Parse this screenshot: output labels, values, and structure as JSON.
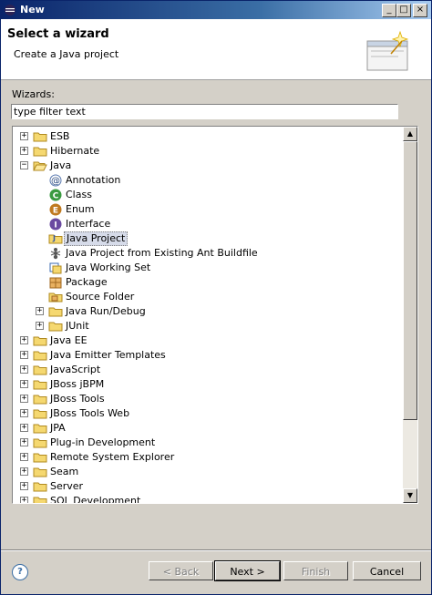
{
  "window": {
    "title": "New",
    "controls": [
      "_",
      "□",
      "×"
    ]
  },
  "header": {
    "title": "Select a wizard",
    "description": "Create a Java project"
  },
  "wizards_label": "Wizards:",
  "filter": {
    "value": "type filter text",
    "placeholder": "type filter text"
  },
  "tree": {
    "nodes": [
      {
        "label": "ESB",
        "level": 0,
        "expander": "+",
        "icon": "folder-icon"
      },
      {
        "label": "Hibernate",
        "level": 0,
        "expander": "+",
        "icon": "folder-icon"
      },
      {
        "label": "Java",
        "level": 0,
        "expander": "−",
        "icon": "folder-open-icon"
      },
      {
        "label": "Annotation",
        "level": 1,
        "expander": "",
        "icon": "annotation-icon"
      },
      {
        "label": "Class",
        "level": 1,
        "expander": "",
        "icon": "class-icon"
      },
      {
        "label": "Enum",
        "level": 1,
        "expander": "",
        "icon": "enum-icon"
      },
      {
        "label": "Interface",
        "level": 1,
        "expander": "",
        "icon": "interface-icon"
      },
      {
        "label": "Java Project",
        "level": 1,
        "expander": "",
        "icon": "java-project-icon",
        "selected": true
      },
      {
        "label": "Java Project from Existing Ant Buildfile",
        "level": 1,
        "expander": "",
        "icon": "ant-icon"
      },
      {
        "label": "Java Working Set",
        "level": 1,
        "expander": "",
        "icon": "working-set-icon"
      },
      {
        "label": "Package",
        "level": 1,
        "expander": "",
        "icon": "package-icon"
      },
      {
        "label": "Source Folder",
        "level": 1,
        "expander": "",
        "icon": "source-folder-icon"
      },
      {
        "label": "Java Run/Debug",
        "level": 1,
        "expander": "+",
        "icon": "folder-icon"
      },
      {
        "label": "JUnit",
        "level": 1,
        "expander": "+",
        "icon": "folder-icon"
      },
      {
        "label": "Java EE",
        "level": 0,
        "expander": "+",
        "icon": "folder-icon"
      },
      {
        "label": "Java Emitter Templates",
        "level": 0,
        "expander": "+",
        "icon": "folder-icon"
      },
      {
        "label": "JavaScript",
        "level": 0,
        "expander": "+",
        "icon": "folder-icon"
      },
      {
        "label": "JBoss jBPM",
        "level": 0,
        "expander": "+",
        "icon": "folder-icon"
      },
      {
        "label": "JBoss Tools",
        "level": 0,
        "expander": "+",
        "icon": "folder-icon"
      },
      {
        "label": "JBoss Tools Web",
        "level": 0,
        "expander": "+",
        "icon": "folder-icon"
      },
      {
        "label": "JPA",
        "level": 0,
        "expander": "+",
        "icon": "folder-icon"
      },
      {
        "label": "Plug-in Development",
        "level": 0,
        "expander": "+",
        "icon": "folder-icon"
      },
      {
        "label": "Remote System Explorer",
        "level": 0,
        "expander": "+",
        "icon": "folder-icon"
      },
      {
        "label": "Seam",
        "level": 0,
        "expander": "+",
        "icon": "folder-icon"
      },
      {
        "label": "Server",
        "level": 0,
        "expander": "+",
        "icon": "folder-icon"
      },
      {
        "label": "SQL Development",
        "level": 0,
        "expander": "+",
        "icon": "folder-icon"
      }
    ]
  },
  "buttons": {
    "help": "?",
    "back": "< Back",
    "next": "Next >",
    "finish": "Finish",
    "cancel": "Cancel"
  },
  "colors": {
    "titlebar_start": "#0a246a",
    "titlebar_end": "#a6caf0",
    "selection": "#d6dbe9",
    "dialog_bg": "#d4d0c8"
  }
}
